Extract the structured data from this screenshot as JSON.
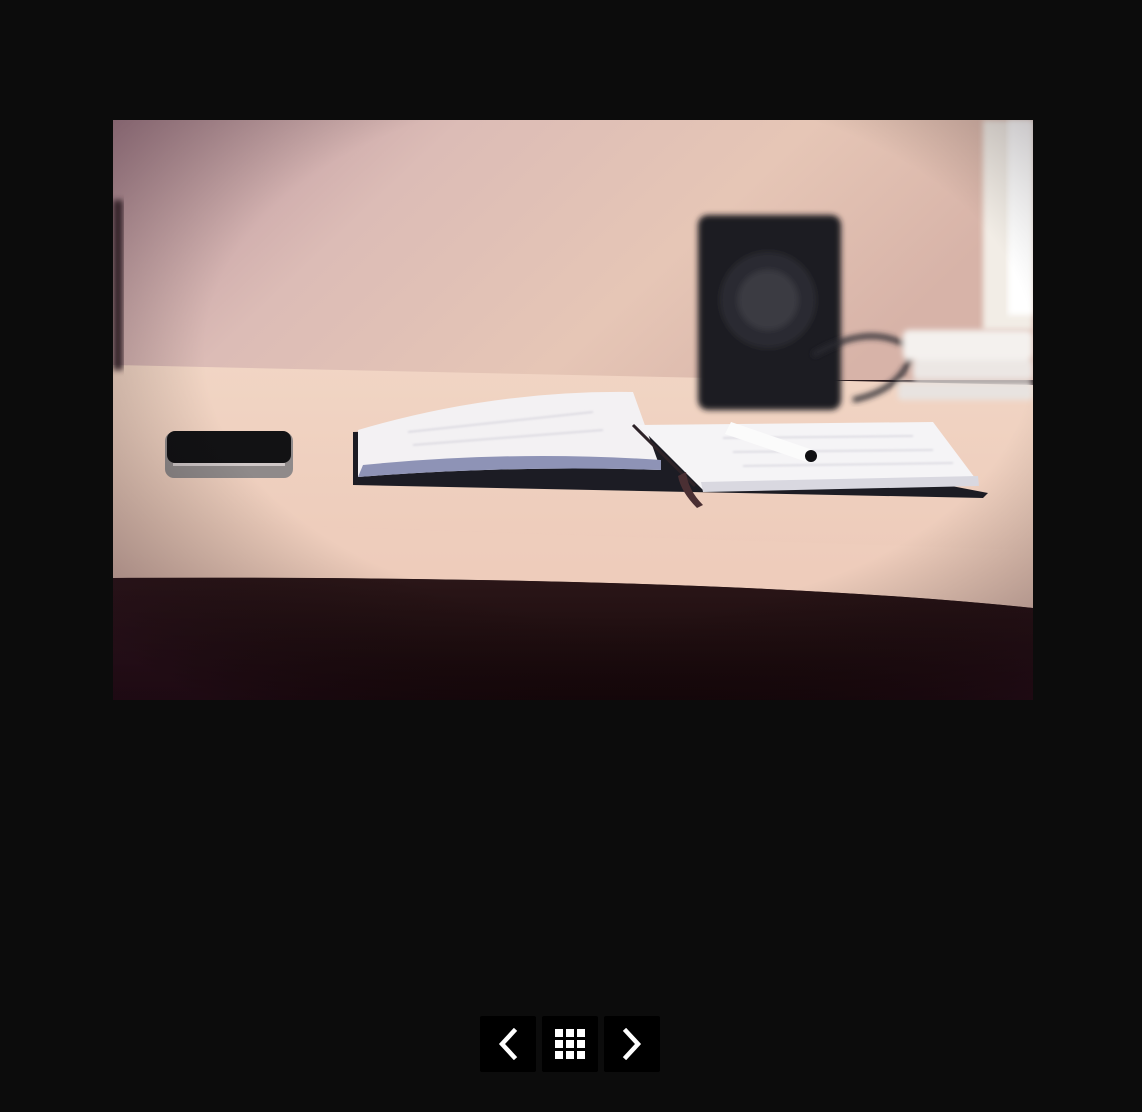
{
  "viewer": {
    "photo_subject": "desk-photo",
    "background_color": "#0c0c0c"
  },
  "controls": {
    "prev_icon": "chevron-left-icon",
    "grid_icon": "grid-icon",
    "next_icon": "chevron-right-icon",
    "button_color": "#000000",
    "icon_color": "#ffffff"
  }
}
